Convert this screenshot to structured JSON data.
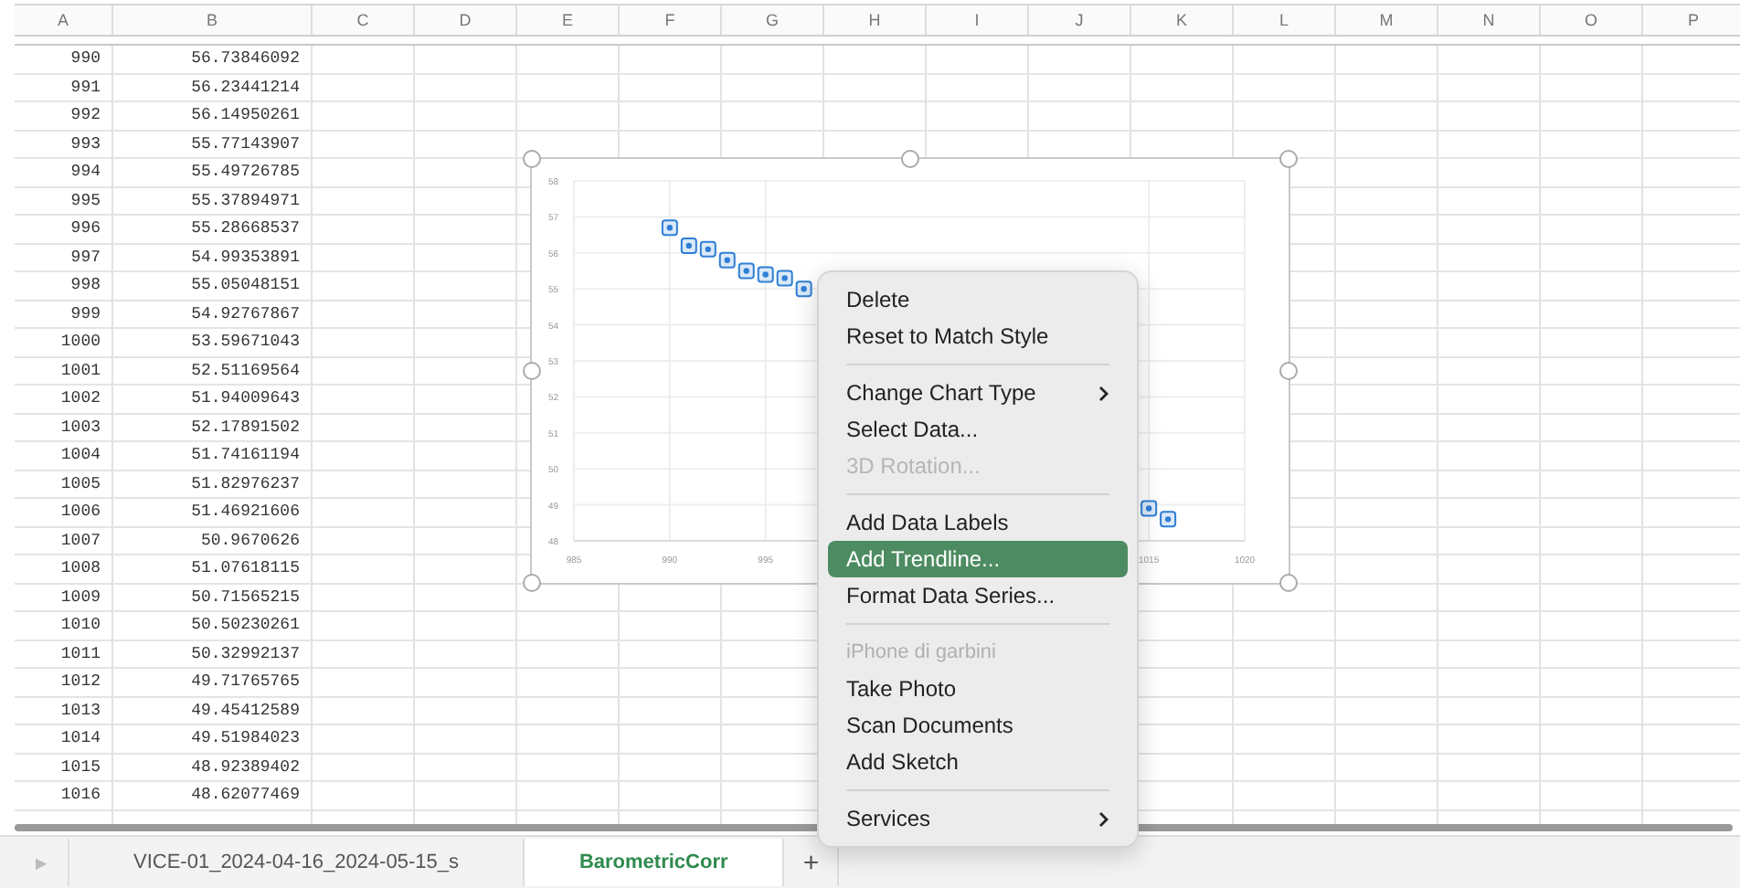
{
  "columns": [
    "A",
    "B",
    "C",
    "D",
    "E",
    "F",
    "G",
    "H",
    "I",
    "J",
    "K",
    "L",
    "M",
    "N",
    "O",
    "P"
  ],
  "rows": [
    {
      "a": "990",
      "b": "56.73846092"
    },
    {
      "a": "991",
      "b": "56.23441214"
    },
    {
      "a": "992",
      "b": "56.14950261"
    },
    {
      "a": "993",
      "b": "55.77143907"
    },
    {
      "a": "994",
      "b": "55.49726785"
    },
    {
      "a": "995",
      "b": "55.37894971"
    },
    {
      "a": "996",
      "b": "55.28668537"
    },
    {
      "a": "997",
      "b": "54.99353891"
    },
    {
      "a": "998",
      "b": "55.05048151"
    },
    {
      "a": "999",
      "b": "54.92767867"
    },
    {
      "a": "1000",
      "b": "53.59671043"
    },
    {
      "a": "1001",
      "b": "52.51169564"
    },
    {
      "a": "1002",
      "b": "51.94009643"
    },
    {
      "a": "1003",
      "b": "52.17891502"
    },
    {
      "a": "1004",
      "b": "51.74161194"
    },
    {
      "a": "1005",
      "b": "51.82976237"
    },
    {
      "a": "1006",
      "b": "51.46921606"
    },
    {
      "a": "1007",
      "b": "50.9670626"
    },
    {
      "a": "1008",
      "b": "51.07618115"
    },
    {
      "a": "1009",
      "b": "50.71565215"
    },
    {
      "a": "1010",
      "b": "50.50230261"
    },
    {
      "a": "1011",
      "b": "50.32992137"
    },
    {
      "a": "1012",
      "b": "49.71765765"
    },
    {
      "a": "1013",
      "b": "49.45412589"
    },
    {
      "a": "1014",
      "b": "49.51984023"
    },
    {
      "a": "1015",
      "b": "48.92389402"
    },
    {
      "a": "1016",
      "b": "48.62077469"
    }
  ],
  "chart": {
    "chart_data": {
      "type": "scatter",
      "x": [
        990,
        991,
        992,
        993,
        994,
        995,
        996,
        997,
        1015,
        1016
      ],
      "series": [
        {
          "color": "#2f7fd6",
          "values": [
            56.7,
            56.2,
            56.1,
            55.8,
            55.5,
            55.4,
            55.3,
            55.0,
            48.9,
            48.6
          ]
        }
      ],
      "xlim": [
        985,
        1020
      ],
      "ylim": [
        48,
        58
      ],
      "grid": true,
      "xticks": [
        985,
        990,
        995,
        1015,
        1020
      ],
      "yticks": [
        48,
        49,
        50,
        51,
        52,
        53,
        54,
        55,
        56,
        57,
        58
      ]
    }
  },
  "menu": {
    "items": [
      {
        "kind": "item",
        "label": "Delete",
        "selected": false,
        "disabled": false,
        "submenu": false
      },
      {
        "kind": "item",
        "label": "Reset to Match Style",
        "selected": false,
        "disabled": false,
        "submenu": false
      },
      {
        "kind": "separator"
      },
      {
        "kind": "item",
        "label": "Change Chart Type",
        "selected": false,
        "disabled": false,
        "submenu": true
      },
      {
        "kind": "item",
        "label": "Select Data...",
        "selected": false,
        "disabled": false,
        "submenu": false
      },
      {
        "kind": "item",
        "label": "3D Rotation...",
        "selected": false,
        "disabled": true,
        "submenu": false
      },
      {
        "kind": "separator"
      },
      {
        "kind": "item",
        "label": "Add Data Labels",
        "selected": false,
        "disabled": false,
        "submenu": false
      },
      {
        "kind": "item",
        "label": "Add Trendline...",
        "selected": true,
        "disabled": false,
        "submenu": false
      },
      {
        "kind": "item",
        "label": "Format Data Series...",
        "selected": false,
        "disabled": false,
        "submenu": false
      },
      {
        "kind": "separator"
      },
      {
        "kind": "header",
        "label": "iPhone di garbini"
      },
      {
        "kind": "item",
        "label": "Take Photo",
        "selected": false,
        "disabled": false,
        "submenu": false
      },
      {
        "kind": "item",
        "label": "Scan Documents",
        "selected": false,
        "disabled": false,
        "submenu": false
      },
      {
        "kind": "item",
        "label": "Add Sketch",
        "selected": false,
        "disabled": false,
        "submenu": false
      },
      {
        "kind": "separator"
      },
      {
        "kind": "item",
        "label": "Services",
        "selected": false,
        "disabled": false,
        "submenu": true
      }
    ]
  },
  "tab_bar": {
    "nav_arrow": "▶",
    "sheet_tabs": [
      {
        "label": "VICE-01_2024-04-16_2024-05-15_s",
        "selected": false
      },
      {
        "label": "BarometricCorr",
        "selected": true
      }
    ],
    "add_tab": "+"
  }
}
